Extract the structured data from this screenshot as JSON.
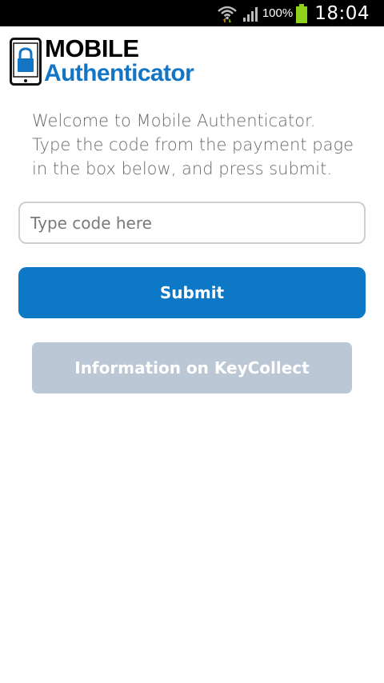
{
  "status_bar": {
    "battery_percent": "100%",
    "time": "18:04",
    "icons": [
      "wifi-icon",
      "signal-icon",
      "battery-icon"
    ]
  },
  "logo": {
    "line1": "MOBILE",
    "line2": "Authenticator",
    "colors": {
      "line1": "#000000",
      "line2": "#1475c4"
    }
  },
  "intro": {
    "line1": "Welcome to Mobile Authenticator.",
    "line2": "Type the code from the payment page",
    "line3": "in the box below, and press submit."
  },
  "code_input": {
    "placeholder": "Type code here",
    "value": ""
  },
  "buttons": {
    "submit_label": "Submit",
    "info_label": "Information on KeyCollect"
  },
  "colors": {
    "accent": "#0d78c6",
    "info_button": "#bcc7d6"
  }
}
